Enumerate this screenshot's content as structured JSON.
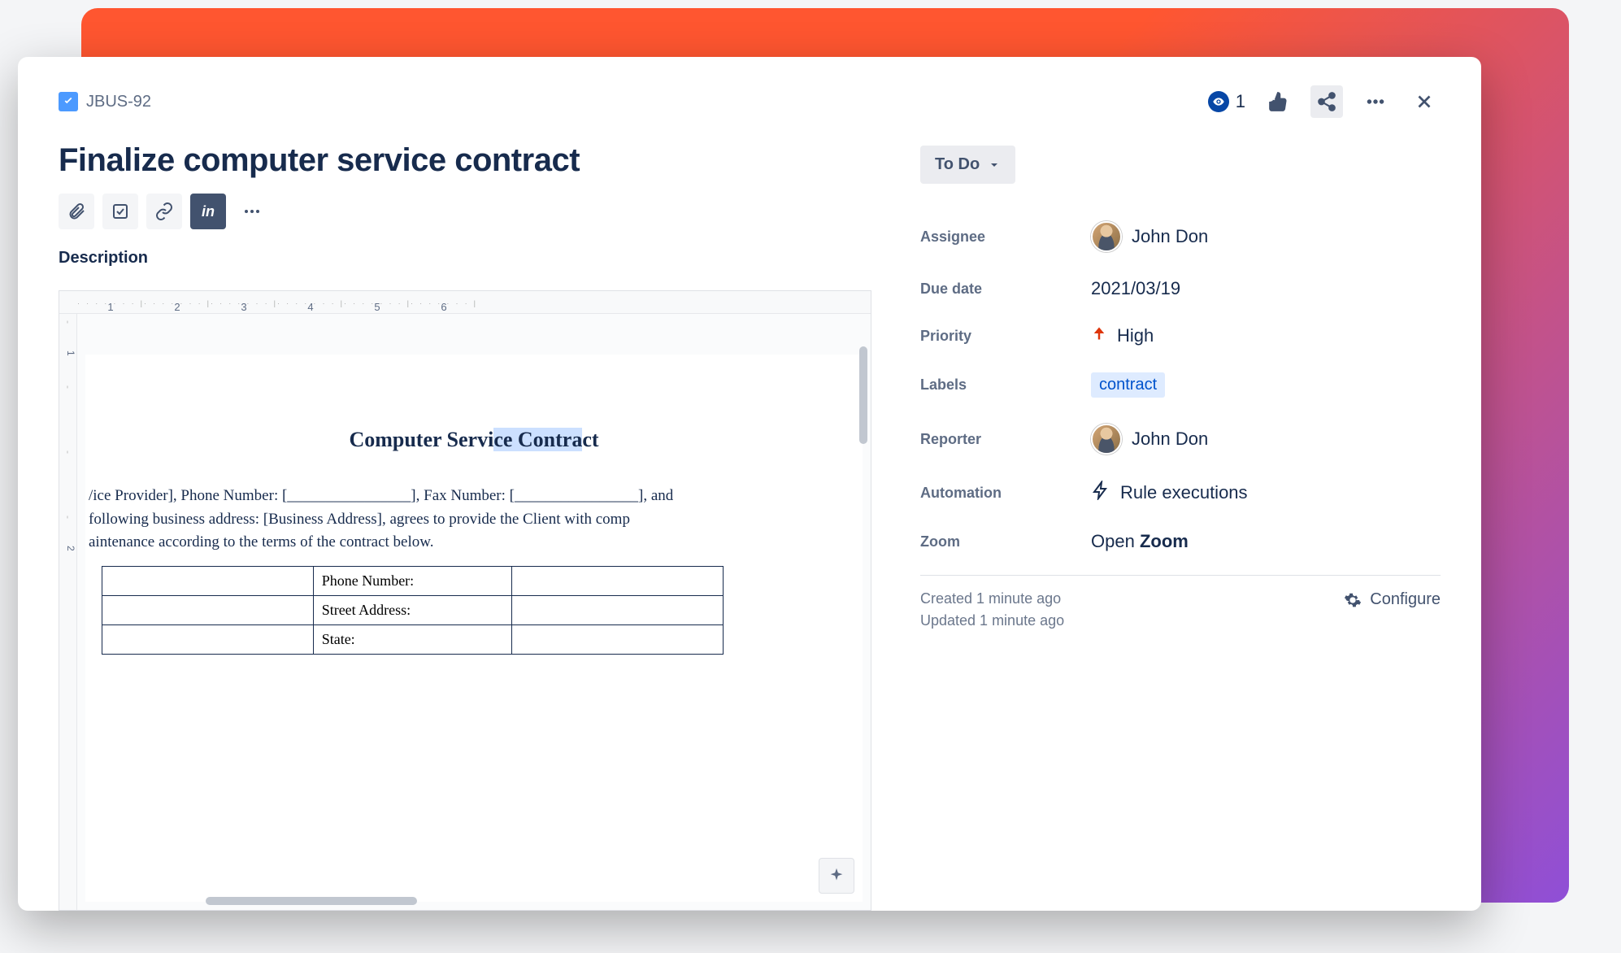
{
  "issue": {
    "key": "JBUS-92",
    "title": "Finalize computer service contract",
    "watch_count": "1",
    "description_label": "Description"
  },
  "status": {
    "label": "To Do"
  },
  "fields": {
    "assignee_label": "Assignee",
    "assignee_value": "John Don",
    "due_date_label": "Due date",
    "due_date_value": "2021/03/19",
    "priority_label": "Priority",
    "priority_value": "High",
    "labels_label": "Labels",
    "labels_value": "contract",
    "reporter_label": "Reporter",
    "reporter_value": "John Don",
    "automation_label": "Automation",
    "automation_value": "Rule executions",
    "zoom_label": "Zoom",
    "zoom_value_prefix": "Open ",
    "zoom_value_bold": "Zoom"
  },
  "footer": {
    "created": "Created 1 minute ago",
    "updated": "Updated 1 minute ago",
    "configure": "Configure"
  },
  "document": {
    "ruler_h": [
      "1",
      "2",
      "3",
      "4",
      "5",
      "6"
    ],
    "ruler_v": [
      "1",
      "",
      "",
      "2"
    ],
    "title_plain": "Computer Servi",
    "title_hl": "ce Contra",
    "title_end": "ct",
    "line1": "/ice Provider], Phone Number: [________________], Fax Number: [________________], and",
    "line2": "following business address: [Business Address], agrees to provide the Client with comp",
    "line3": "aintenance according to the terms of the contract below.",
    "table": {
      "r1c2": "Phone Number:",
      "r2c2": "Street Address:",
      "r3c2": "State:"
    }
  }
}
